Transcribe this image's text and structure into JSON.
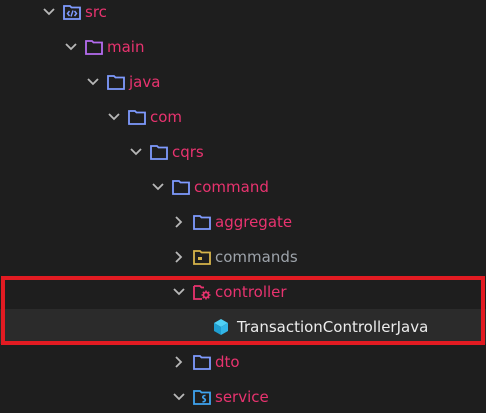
{
  "tree": {
    "items": [
      {
        "label": "src",
        "expanded": true,
        "icon": "source-folder-icon"
      },
      {
        "label": "main",
        "expanded": true,
        "icon": "folder-icon"
      },
      {
        "label": "java",
        "expanded": true,
        "icon": "folder-icon"
      },
      {
        "label": "com",
        "expanded": true,
        "icon": "folder-icon"
      },
      {
        "label": "cqrs",
        "expanded": true,
        "icon": "folder-icon"
      },
      {
        "label": "command",
        "expanded": true,
        "icon": "folder-icon"
      },
      {
        "label": "aggregate",
        "expanded": false,
        "icon": "folder-icon"
      },
      {
        "label": "commands",
        "expanded": false,
        "icon": "package-folder-icon"
      },
      {
        "label": "controller",
        "expanded": true,
        "icon": "controller-folder-icon"
      },
      {
        "label": "TransactionControllerJava",
        "expanded": null,
        "icon": "java-class-icon",
        "selected": true
      },
      {
        "label": "dto",
        "expanded": false,
        "icon": "folder-icon"
      },
      {
        "label": "service",
        "expanded": true,
        "icon": "service-folder-icon"
      }
    ]
  },
  "colors": {
    "background": "#1e1e1e",
    "selected_row": "#2b2b2b",
    "label_pink": "#e8336f",
    "label_gray": "#9da3aa",
    "label_white": "#ececec",
    "folder_blue": "#7f9bff",
    "folder_purple": "#b56cf0",
    "folder_yellow": "#d6b44a",
    "folder_red": "#e8336f",
    "service_blue": "#3fa4f0",
    "class_cyan": "#32b6e8",
    "highlight_red": "#e21b22"
  }
}
